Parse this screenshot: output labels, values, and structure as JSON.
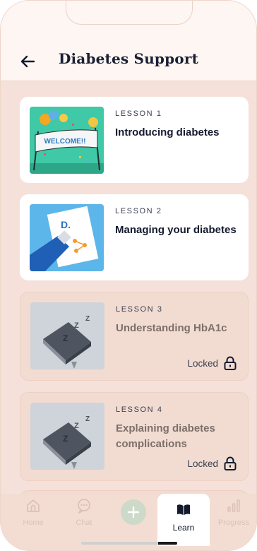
{
  "header": {
    "title": "Diabetes Support"
  },
  "lessons": [
    {
      "eyebrow": "LESSON 1",
      "title": "Introducing diabetes",
      "locked": false,
      "thumb_text": "WELCOME!!"
    },
    {
      "eyebrow": "LESSON 2",
      "title": "Managing your diabetes",
      "locked": false,
      "thumb_text": "D."
    },
    {
      "eyebrow": "LESSON 3",
      "title": "Understanding HbA1c",
      "locked": true,
      "lock_label": "Locked"
    },
    {
      "eyebrow": "LESSON 4",
      "title": "Explaining diabetes complications",
      "locked": true,
      "lock_label": "Locked"
    }
  ],
  "tabs": [
    {
      "label": "Home",
      "icon": "home-icon",
      "active": false
    },
    {
      "label": "Chat",
      "icon": "chat-icon",
      "active": false
    },
    {
      "label": "",
      "icon": "plus-icon",
      "active": false
    },
    {
      "label": "Learn",
      "icon": "book-icon",
      "active": true
    },
    {
      "label": "Progress",
      "icon": "bar-chart-icon",
      "active": false
    }
  ],
  "colors": {
    "background": "#f5e1d9",
    "card": "#ffffff",
    "locked_card": "#f2dcd1",
    "text": "#141a2e",
    "accent_green": "#cdd9c9"
  }
}
